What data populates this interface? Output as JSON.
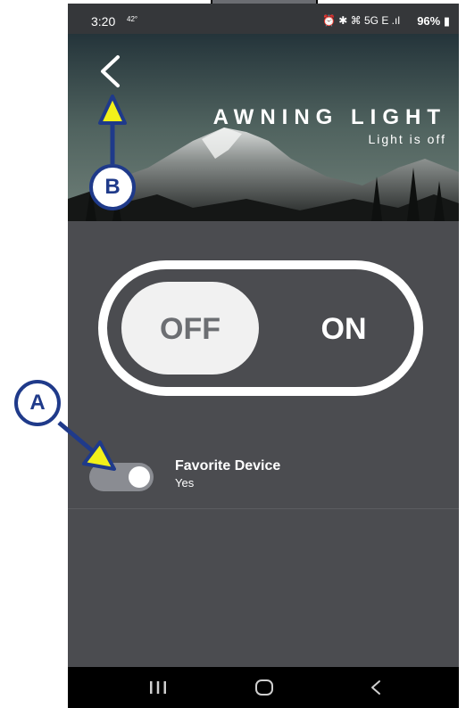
{
  "status_bar": {
    "time": "3:20",
    "temperature": "42°",
    "icons": "⏰ ✱ ⌘ 5G E .ıl",
    "battery": "96%"
  },
  "header": {
    "title": "AWNING LIGHT",
    "subtitle": "Light is off"
  },
  "main_toggle": {
    "off_label": "OFF",
    "on_label": "ON",
    "state": "off"
  },
  "favorite": {
    "label": "Favorite Device",
    "value": "Yes"
  },
  "annotations": {
    "a_label": "A",
    "b_label": "B"
  },
  "colors": {
    "accent_annotation": "#1f3a8a",
    "arrow_fill": "#f2f01a",
    "content_bg": "#4b4c50"
  }
}
